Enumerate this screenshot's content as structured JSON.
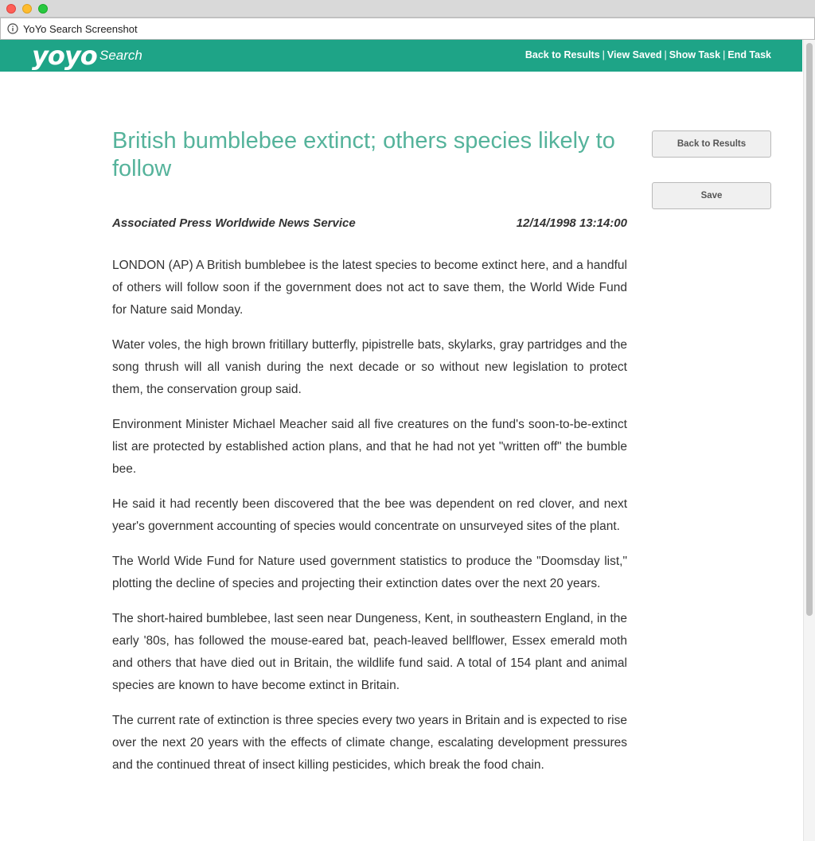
{
  "window": {
    "title": "YoYo Search Screenshot"
  },
  "header": {
    "logo": "yoyo",
    "logo_sub": "Search",
    "nav": {
      "back_to_results": "Back to Results",
      "view_saved": "View Saved",
      "show_task": "Show Task",
      "end_task": "End Task",
      "separator": "|"
    }
  },
  "sidebar": {
    "back_label": "Back to Results",
    "save_label": "Save"
  },
  "article": {
    "headline": "British bumblebee extinct; others species likely to follow",
    "source": "Associated Press Worldwide News Service",
    "datetime": "12/14/1998 13:14:00",
    "paragraphs": [
      "LONDON (AP) A British bumblebee is the latest species to become extinct here, and a handful of others will follow soon if the government does not act to save them, the World Wide Fund for Nature said Monday.",
      "Water voles, the high brown fritillary butterfly, pipistrelle bats, skylarks, gray partridges and the song thrush will all vanish during the next decade or so without new legislation to protect them, the conservation group said.",
      "Environment Minister Michael Meacher said all five creatures on the fund's soon-to-be-extinct list are protected by established action plans, and that he had not yet \"written off\" the bumble bee.",
      "He said it had recently been discovered that the bee was dependent on red clover, and next year's government accounting of species would concentrate on unsurveyed sites of the plant.",
      "The World Wide Fund for Nature used government statistics to produce the \"Doomsday list,\" plotting the decline of species and projecting their extinction dates over the next 20 years.",
      "The short-haired bumblebee, last seen near Dungeness, Kent, in southeastern England, in the early '80s, has followed the mouse-eared bat, peach-leaved bellflower, Essex emerald moth and others that have died out in Britain, the wildlife fund said. A total of 154 plant and animal species are known to have become extinct in Britain.",
      "The current rate of extinction is three species every two years in Britain and is expected to rise over the next 20 years with the effects of climate change, escalating development pressures and the continued threat of insect killing pesticides, which break the food chain."
    ]
  },
  "colors": {
    "header_bg": "#1ea487",
    "headline": "#55b39b"
  }
}
